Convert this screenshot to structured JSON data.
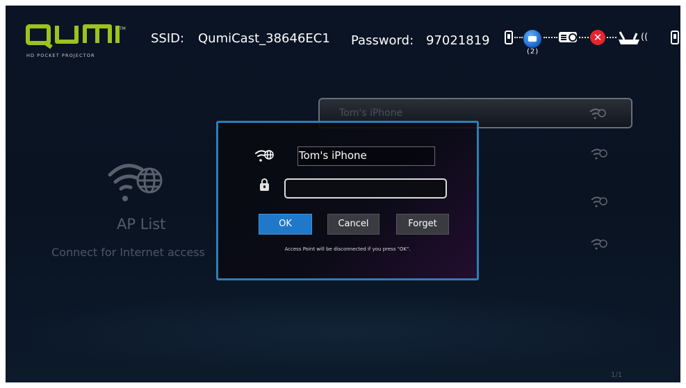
{
  "header": {
    "brand": "QUMI",
    "brand_tagline": "HD POCKET PROJECTOR",
    "trademark": "TM",
    "ssid_label": "SSID:",
    "ssid_value": "QumiCast_38646EC1",
    "password_label": "Password:",
    "password_value": "97021819",
    "connected_count": "(2)"
  },
  "background": {
    "title": "AP List",
    "subtitle": "Connect for Internet access",
    "list_items": [
      {
        "name": "Tom's iPhone",
        "selected": true
      },
      {
        "name": "",
        "selected": false
      },
      {
        "name": "",
        "selected": false
      },
      {
        "name": "",
        "selected": false
      }
    ]
  },
  "dialog": {
    "ap_name": "Tom's iPhone",
    "password_value": "",
    "ok_label": "OK",
    "cancel_label": "Cancel",
    "forget_label": "Forget",
    "warning": "Access Point will be disconnected if you press \"OK\"."
  },
  "footer": {
    "page_indicator": "1/1"
  },
  "colors": {
    "accent_green": "#9bc21f",
    "dialog_border": "#2c7fb8",
    "ok_button": "#1f78c8",
    "error_red": "#e8242f"
  },
  "icons": {
    "wifi": "wifi-globe-icon",
    "lock": "lock-icon",
    "router": "router-icon",
    "projector": "projector-icon",
    "phone": "phone-icon",
    "disconnect": "x-circle-icon"
  }
}
